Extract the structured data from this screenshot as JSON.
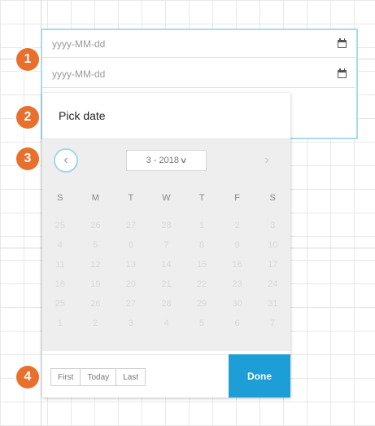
{
  "date_fields": [
    {
      "placeholder": "yyyy-MM-dd",
      "icon": "calendar-icon"
    },
    {
      "placeholder": "yyyy-MM-dd",
      "icon": "calendar-icon"
    }
  ],
  "picker": {
    "header_title": "Pick date",
    "prev_icon": "chevron-left-icon",
    "next_icon": "chevron-right-icon",
    "month_label": "3 - 2018",
    "month_chevron": "chevron-down-icon",
    "weekdays": [
      "S",
      "M",
      "T",
      "W",
      "T",
      "F",
      "S"
    ],
    "days": [
      "25",
      "26",
      "27",
      "28",
      "1",
      "2",
      "3",
      "4",
      "5",
      "6",
      "7",
      "8",
      "9",
      "10",
      "11",
      "12",
      "13",
      "14",
      "15",
      "16",
      "17",
      "18",
      "19",
      "20",
      "21",
      "22",
      "23",
      "24",
      "25",
      "26",
      "27",
      "28",
      "29",
      "30",
      "31",
      "1",
      "2",
      "3",
      "4",
      "5",
      "6",
      "7"
    ],
    "footer": {
      "first_label": "First",
      "today_label": "Today",
      "last_label": "Last",
      "done_label": "Done"
    }
  },
  "markers": [
    "1",
    "2",
    "3",
    "4"
  ],
  "colors": {
    "marker": "#e8702c",
    "done": "#1d9ed7",
    "focus_border": "#a7dcef"
  }
}
